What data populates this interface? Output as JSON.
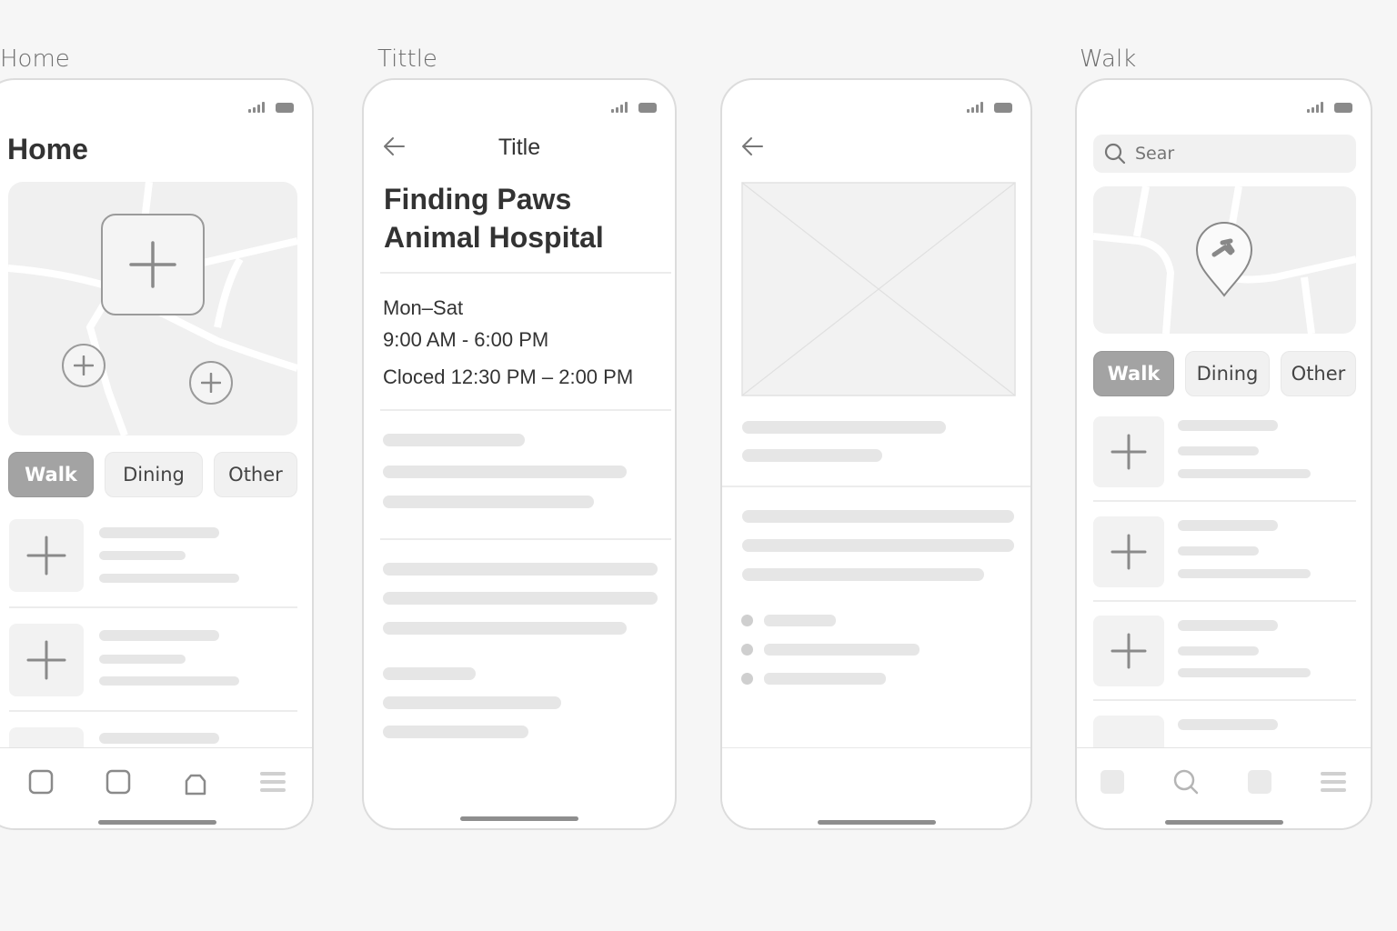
{
  "labels": {
    "p1": "Home",
    "p2": "Tittle",
    "p3": "",
    "p4": "Walk"
  },
  "home": {
    "heading": "Home",
    "chips": [
      "Walk",
      "Dining",
      "Other"
    ],
    "active_chip": "Walk",
    "nav_icons": [
      "square-icon",
      "square-icon",
      "bag-icon",
      "menu-icon"
    ]
  },
  "detail": {
    "nav_title": "Title",
    "name_line1": "Finding Paws",
    "name_line2": "Animal Hospital",
    "days": "Mon–Sat",
    "hours": "9:00 AM - 6:00 PM",
    "closed": "Cloced 12:30 PM – 2:00 PM"
  },
  "walk": {
    "search_placeholder": "Sear",
    "chips": [
      "Walk",
      "Dining",
      "Other"
    ],
    "active_chip": "Walk",
    "nav_icons": [
      "square-icon",
      "search-icon",
      "square-icon",
      "menu-icon"
    ]
  },
  "colors": {
    "background": "#f6f6f6",
    "active_chip": "#a3a3a3",
    "skeleton": "#e6e6e6",
    "icon": "#8a8a8a"
  }
}
